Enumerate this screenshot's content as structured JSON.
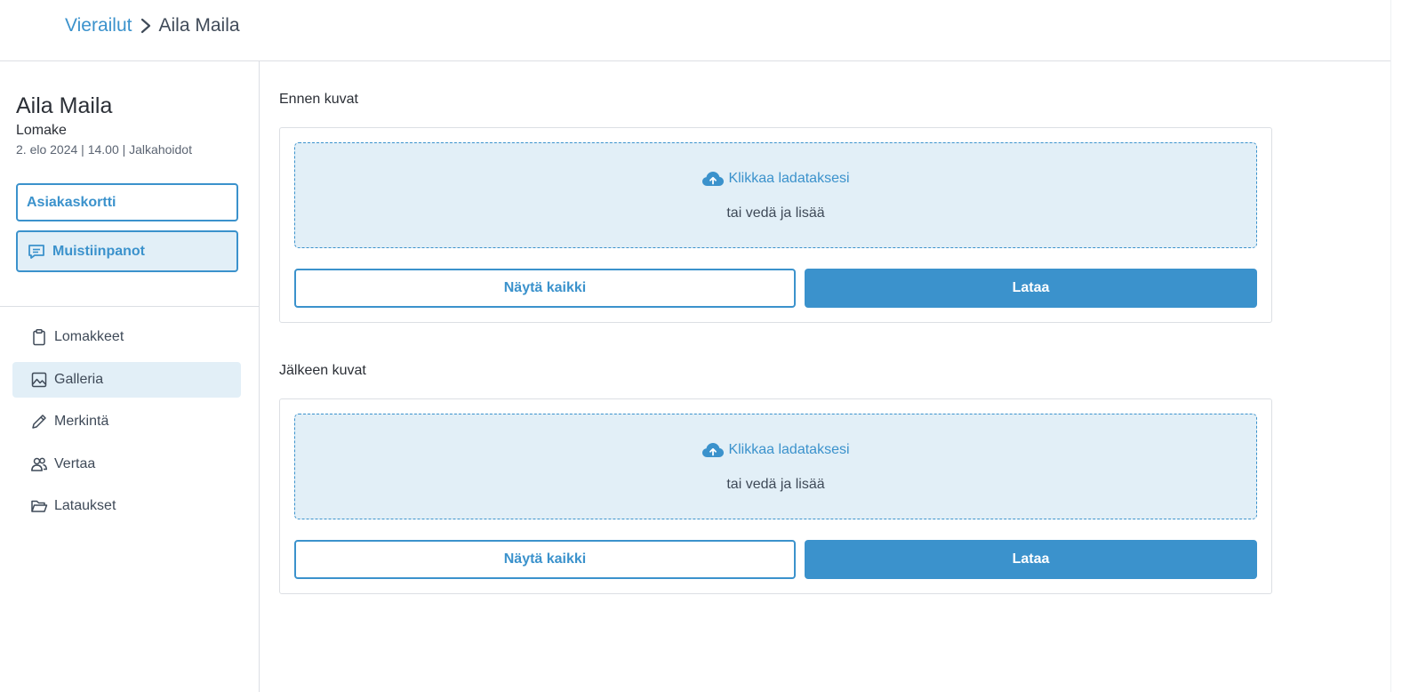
{
  "breadcrumb": {
    "parent": "Vierailut",
    "current": "Aila Maila"
  },
  "client": {
    "name": "Aila Maila",
    "form_label": "Lomake",
    "meta": "2. elo 2024 | 14.00 | Jalkahoidot"
  },
  "actions": {
    "card_label": "Asiakaskortti",
    "notes_label": "Muistiinpanot"
  },
  "nav": {
    "items": [
      {
        "label": "Lomakkeet",
        "icon": "clipboard-icon"
      },
      {
        "label": "Galleria",
        "icon": "image-icon",
        "active": true
      },
      {
        "label": "Merkintä",
        "icon": "pencil-icon"
      },
      {
        "label": "Vertaa",
        "icon": "users-icon"
      },
      {
        "label": "Lataukset",
        "icon": "folder-icon"
      }
    ]
  },
  "sections": [
    {
      "title": "Ennen kuvat",
      "upload_text": "Klikkaa ladataksesi",
      "drag_text": "tai vedä ja lisää",
      "show_all_label": "Näytä kaikki",
      "upload_label": "Lataa"
    },
    {
      "title": "Jälkeen kuvat",
      "upload_text": "Klikkaa ladataksesi",
      "drag_text": "tai vedä ja lisää",
      "show_all_label": "Näytä kaikki",
      "upload_label": "Lataa"
    }
  ],
  "colors": {
    "accent": "#3b92cc",
    "accent_light": "#e2eff7",
    "border": "#dcdfe4"
  }
}
